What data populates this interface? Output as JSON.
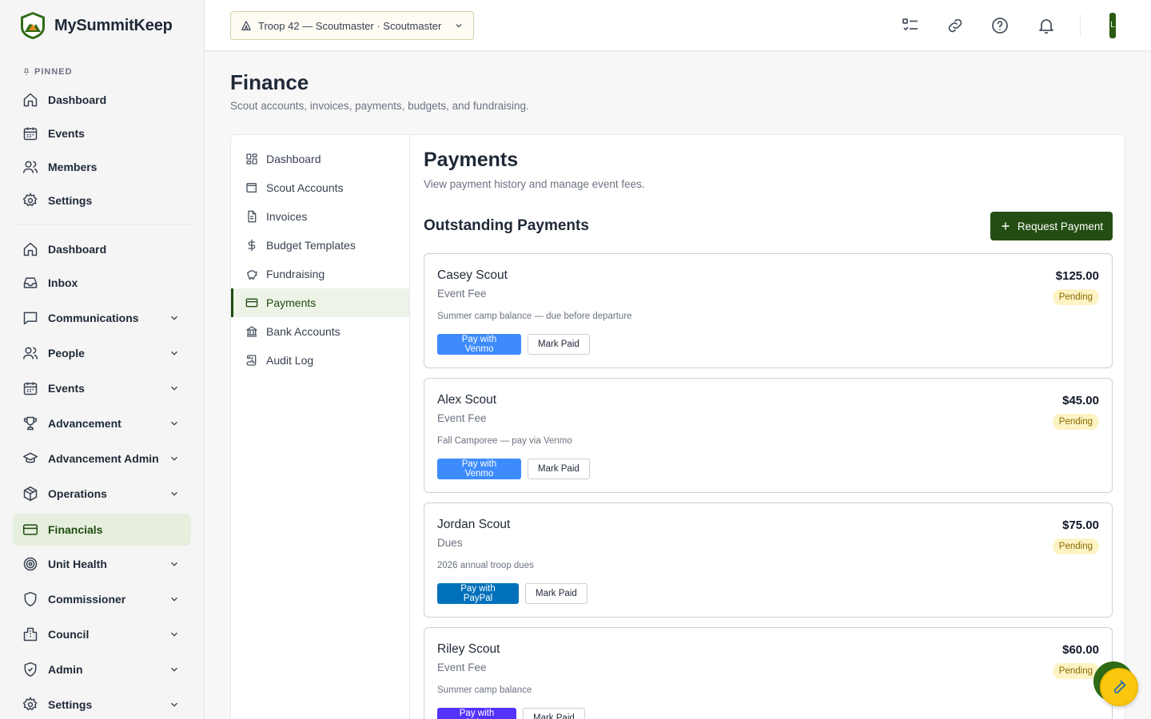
{
  "brand": {
    "name": "MySummitKeep"
  },
  "sidebar": {
    "pinned_label": "PINNED",
    "pinned": [
      {
        "label": "Dashboard",
        "icon": "home-icon"
      },
      {
        "label": "Events",
        "icon": "calendar-icon"
      },
      {
        "label": "Members",
        "icon": "users-icon"
      },
      {
        "label": "Settings",
        "icon": "gear-icon"
      }
    ],
    "items": [
      {
        "label": "Dashboard",
        "icon": "home-icon",
        "expandable": false
      },
      {
        "label": "Inbox",
        "icon": "inbox-icon",
        "expandable": false
      },
      {
        "label": "Communications",
        "icon": "chat-icon",
        "expandable": true
      },
      {
        "label": "People",
        "icon": "users-icon",
        "expandable": true
      },
      {
        "label": "Events",
        "icon": "calendar-icon",
        "expandable": true
      },
      {
        "label": "Advancement",
        "icon": "trophy-icon",
        "expandable": true
      },
      {
        "label": "Advancement Admin",
        "icon": "graduation-cap-icon",
        "expandable": true
      },
      {
        "label": "Operations",
        "icon": "box-icon",
        "expandable": true
      },
      {
        "label": "Financials",
        "icon": "credit-card-icon",
        "expandable": false,
        "active": true
      },
      {
        "label": "Unit Health",
        "icon": "target-icon",
        "expandable": true
      },
      {
        "label": "Commissioner",
        "icon": "shield-icon",
        "expandable": true
      },
      {
        "label": "Council",
        "icon": "building-icon",
        "expandable": true
      },
      {
        "label": "Admin",
        "icon": "shield-check-icon",
        "expandable": true
      },
      {
        "label": "Settings",
        "icon": "gear-icon",
        "expandable": true
      }
    ]
  },
  "header": {
    "unit_selector": "Troop 42 — Scoutmaster · Scoutmaster",
    "avatar_initial": "L",
    "icons": [
      "checklist-icon",
      "link-icon",
      "help-icon",
      "bell-icon"
    ]
  },
  "page": {
    "title": "Finance",
    "subtitle": "Scout accounts, invoices, payments, budgets, and fundraising."
  },
  "subnav": [
    {
      "label": "Dashboard",
      "icon": "grid-icon"
    },
    {
      "label": "Scout Accounts",
      "icon": "wallet-icon"
    },
    {
      "label": "Invoices",
      "icon": "document-icon"
    },
    {
      "label": "Budget Templates",
      "icon": "dollar-icon"
    },
    {
      "label": "Fundraising",
      "icon": "piggy-bank-icon"
    },
    {
      "label": "Payments",
      "icon": "credit-card-icon",
      "active": true
    },
    {
      "label": "Bank Accounts",
      "icon": "bank-icon"
    },
    {
      "label": "Audit Log",
      "icon": "scroll-icon"
    }
  ],
  "payments": {
    "title": "Payments",
    "subtitle": "View payment history and manage event fees.",
    "outstanding_title": "Outstanding Payments",
    "request_button": "Request Payment",
    "mark_paid_label": "Mark Paid",
    "items": [
      {
        "name": "Casey Scout",
        "type": "Event Fee",
        "description": "Summer camp balance — due before departure",
        "amount": "$125.00",
        "status": "Pending",
        "pay_label": "Pay with Venmo",
        "pay_color": "#3d8bfd"
      },
      {
        "name": "Alex Scout",
        "type": "Event Fee",
        "description": "Fall Camporee — pay via Venmo",
        "amount": "$45.00",
        "status": "Pending",
        "pay_label": "Pay with Venmo",
        "pay_color": "#3d8bfd"
      },
      {
        "name": "Jordan Scout",
        "type": "Dues",
        "description": "2026 annual troop dues",
        "amount": "$75.00",
        "status": "Pending",
        "pay_label": "Pay with PayPal",
        "pay_color": "#0070ba"
      },
      {
        "name": "Riley Scout",
        "type": "Event Fee",
        "description": "Summer camp balance",
        "amount": "$60.00",
        "status": "Pending",
        "pay_label": "Pay with Stripe",
        "pay_color": "#5433ff"
      }
    ]
  },
  "colors": {
    "brand_green": "#234d12",
    "active_bg": "#e6eedd",
    "pending_bg": "#fdf3c4",
    "fab": "#f9c80e"
  }
}
